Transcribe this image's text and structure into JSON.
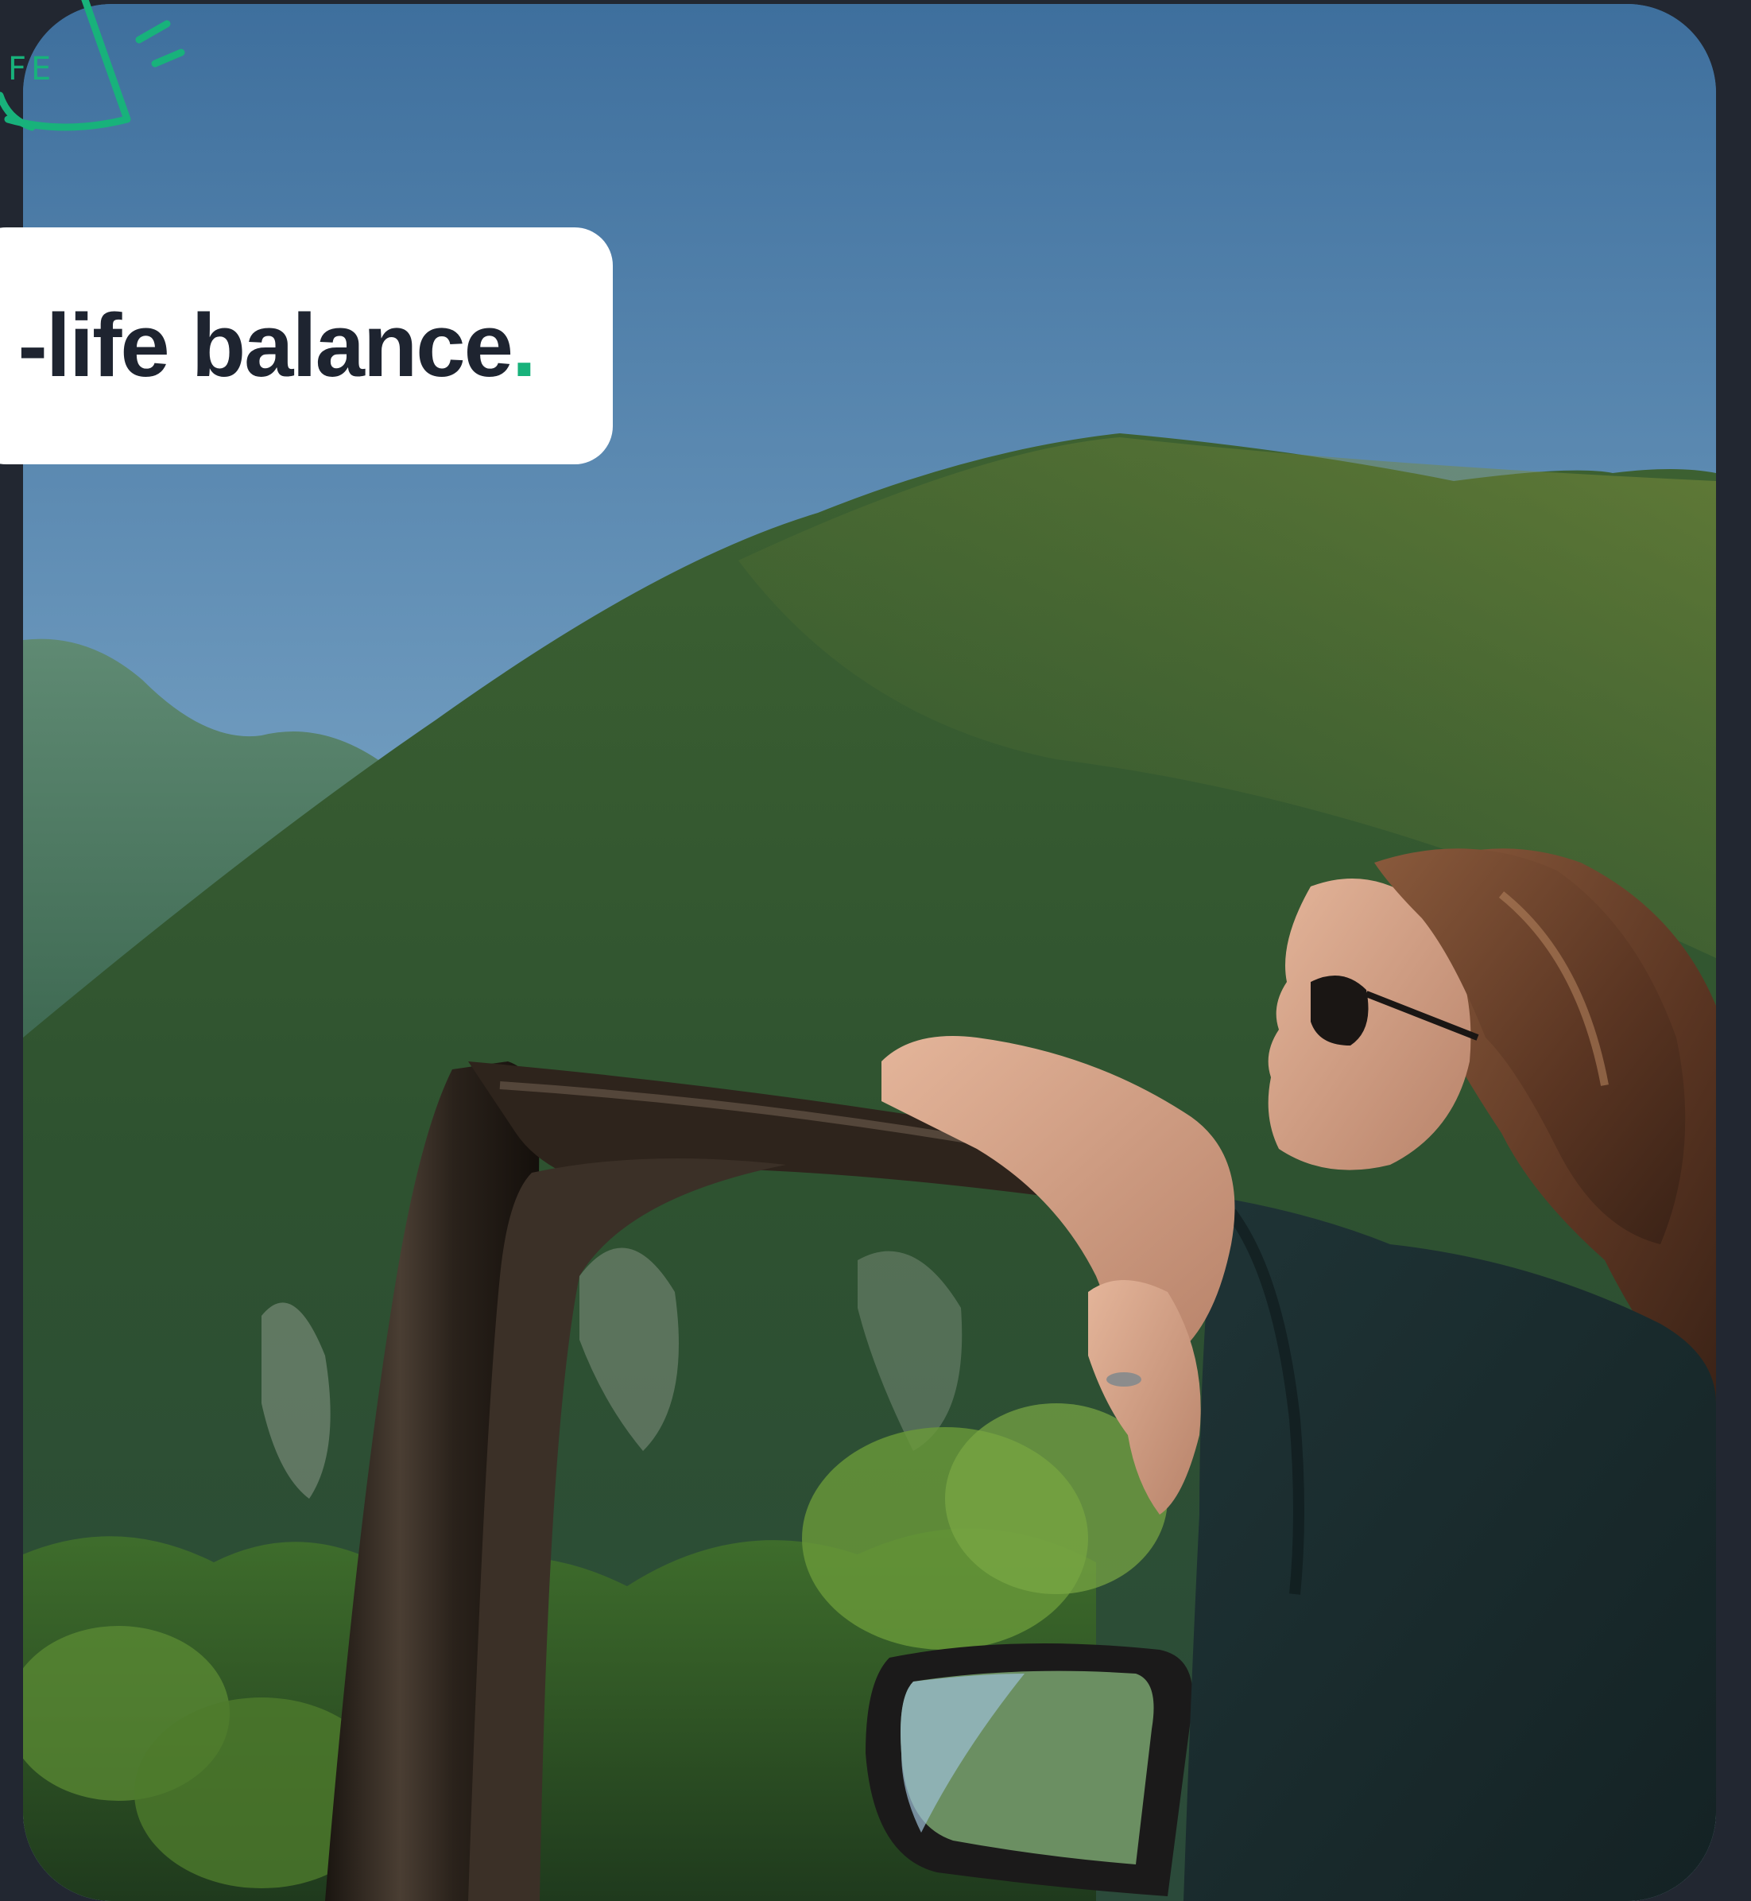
{
  "headline": {
    "text": "-life balance",
    "period": "."
  },
  "doodle": {
    "text": "FE",
    "icon": "megaphone-doodle-icon",
    "color": "#18b27b"
  },
  "photo": {
    "icon": "woman-leaning-on-car-door-photo"
  },
  "colors": {
    "background": "#222731",
    "accent": "#18b27b",
    "headline_text": "#1e2430",
    "card": "#ffffff"
  }
}
